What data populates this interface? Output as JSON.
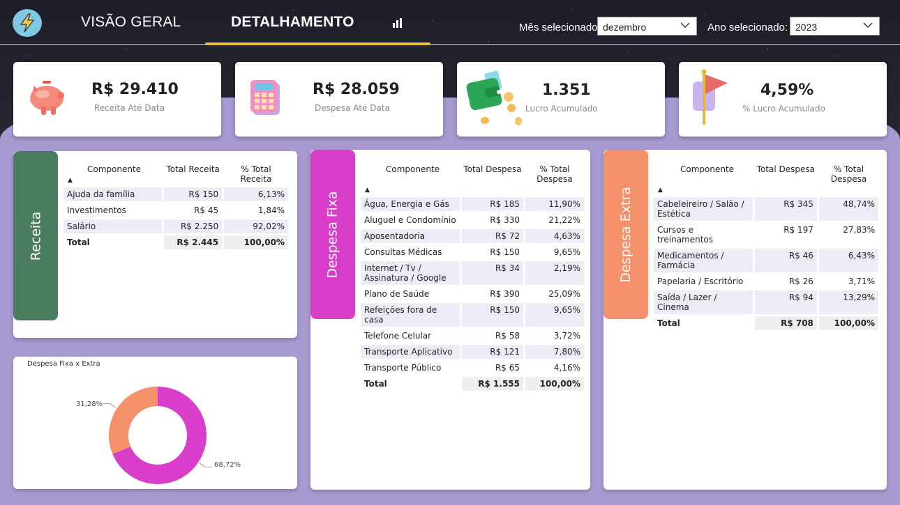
{
  "nav": {
    "visao_geral": "VISÃO GERAL",
    "detalhamento": "DETALHAMENTO",
    "mes_label": "Mês selecionado:",
    "mes_value": "dezembro",
    "ano_label": "Ano selecionado:",
    "ano_value": "2023"
  },
  "kpis": [
    {
      "value": "R$ 29.410",
      "label": "Receita Até Data",
      "icon": "piggy-bank-icon"
    },
    {
      "value": "R$ 28.059",
      "label": "Despesa Até Data",
      "icon": "calculator-icon"
    },
    {
      "value": "1.351",
      "label": "Lucro Acumulado",
      "icon": "wallet-icon"
    },
    {
      "value": "4,59%",
      "label": "% Lucro Acumulado",
      "icon": "flag-icon"
    }
  ],
  "receita": {
    "tab": "Receita",
    "headers": [
      "Componente",
      "Total Receita",
      "% Total Receita"
    ],
    "rows": [
      [
        "Ajuda da família",
        "R$ 150",
        "6,13%"
      ],
      [
        "Investimentos",
        "R$ 45",
        "1,84%"
      ],
      [
        "Salário",
        "R$ 2.250",
        "92,02%"
      ]
    ],
    "total": [
      "Total",
      "R$ 2.445",
      "100,00%"
    ]
  },
  "fixa": {
    "tab": "Despesa Fixa",
    "headers": [
      "Componente",
      "Total Despesa",
      "% Total Despesa"
    ],
    "rows": [
      [
        "Água, Energia e Gás",
        "R$ 185",
        "11,90%"
      ],
      [
        "Aluguel e Condomínio",
        "R$ 330",
        "21,22%"
      ],
      [
        "Aposentadoria",
        "R$ 72",
        "4,63%"
      ],
      [
        "Consultas Médicas",
        "R$ 150",
        "9,65%"
      ],
      [
        "Internet / Tv / Assinatura / Google",
        "R$ 34",
        "2,19%"
      ],
      [
        "Plano de Saúde",
        "R$ 390",
        "25,09%"
      ],
      [
        "Refeições fora de casa",
        "R$ 150",
        "9,65%"
      ],
      [
        "Telefone Celular",
        "R$ 58",
        "3,72%"
      ],
      [
        "Transporte Aplicativo",
        "R$ 121",
        "7,80%"
      ],
      [
        "Transporte Público",
        "R$ 65",
        "4,16%"
      ]
    ],
    "total": [
      "Total",
      "R$ 1.555",
      "100,00%"
    ]
  },
  "extra": {
    "tab": "Despesa Extra",
    "headers": [
      "Componente",
      "Total Despesa",
      "% Total Despesa"
    ],
    "rows": [
      [
        "Cabeleireiro / Salão / Estética",
        "R$ 345",
        "48,74%"
      ],
      [
        "Cursos e treinamentos",
        "R$ 197",
        "27,83%"
      ],
      [
        "Medicamentos / Farmácia",
        "R$ 46",
        "6,43%"
      ],
      [
        "Papelaria / Escritório",
        "R$ 26",
        "3,71%"
      ],
      [
        "Saída / Lazer / Cinema",
        "R$ 94",
        "13,29%"
      ]
    ],
    "total": [
      "Total",
      "R$ 708",
      "100,00%"
    ]
  },
  "chart_data": {
    "type": "pie",
    "title": "Despesa Fixa x Extra",
    "categories": [
      "Despesa Fixa",
      "Despesa Extra"
    ],
    "values": [
      68.72,
      31.28
    ],
    "labels": [
      "68,72%",
      "31,28%"
    ],
    "colors": [
      "#d93ecb",
      "#f4916a"
    ],
    "donut": true
  },
  "colors": {
    "receita": "#4a7c5f",
    "fixa": "#d93ecb",
    "extra": "#f4916a",
    "purple_bg": "#a899d1",
    "accent_underline": "#e8c13a"
  }
}
